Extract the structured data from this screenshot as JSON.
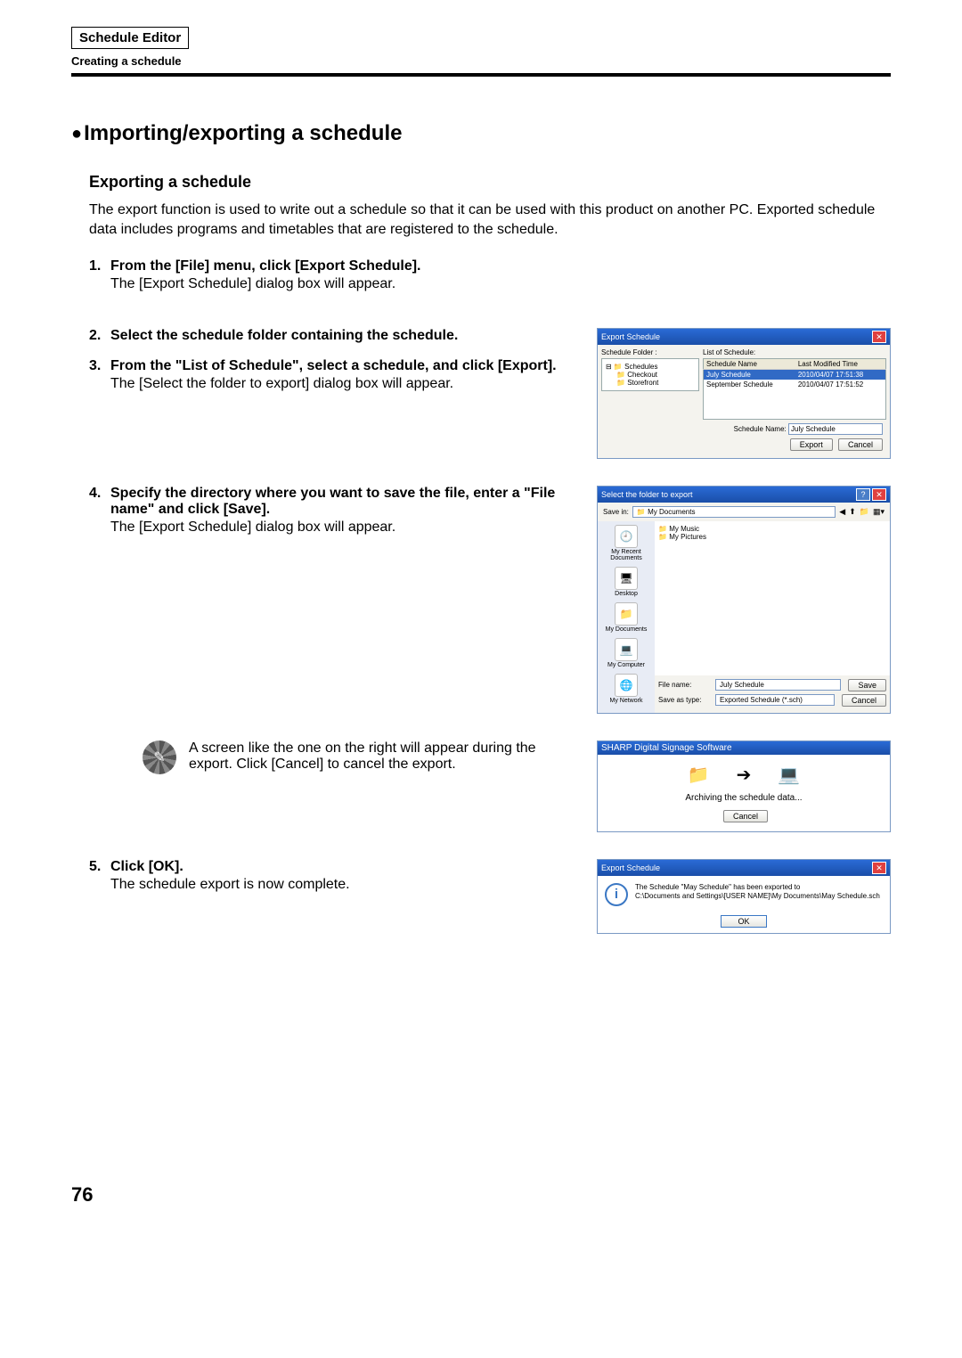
{
  "header": {
    "box": "Schedule Editor",
    "sub": "Creating a schedule"
  },
  "section_title": "Importing/exporting a schedule",
  "sub_title": "Exporting a schedule",
  "intro": "The export function is used to write out a schedule so that it can be used with this product on another PC. Exported schedule data includes programs and timetables that are registered to the schedule.",
  "steps": {
    "s1": {
      "num": "1.",
      "head": "From the [File] menu, click [Export Schedule].",
      "body": "The [Export Schedule] dialog box will appear."
    },
    "s2": {
      "num": "2.",
      "head": "Select the schedule folder containing the schedule."
    },
    "s3": {
      "num": "3.",
      "head": "From the \"List of Schedule\", select a schedule, and click [Export].",
      "body": "The [Select the folder to export] dialog box will appear."
    },
    "s4": {
      "num": "4.",
      "head": "Specify the directory where you want to save the file, enter a \"File name\" and click [Save].",
      "body": "The [Export Schedule] dialog box will appear."
    },
    "note": "A screen like the one on the right will appear during the export. Click [Cancel] to cancel the export.",
    "s5": {
      "num": "5.",
      "head": "Click [OK].",
      "body": "The schedule export is now complete."
    }
  },
  "dlg_export": {
    "title": "Export Schedule",
    "left_label": "Schedule Folder :",
    "tree": [
      "Schedules",
      "Checkout",
      "Storefront"
    ],
    "right_label": "List of Schedule:",
    "col1": "Schedule Name",
    "col2": "Last Modified Time",
    "rows": [
      {
        "name": "July Schedule",
        "time": "2010/04/07 17:51:38"
      },
      {
        "name": "September Schedule",
        "time": "2010/04/07 17:51:52"
      }
    ],
    "name_label": "Schedule Name:",
    "name_value": "July Schedule",
    "export_btn": "Export",
    "cancel_btn": "Cancel"
  },
  "dlg_save": {
    "title": "Select the folder to export",
    "savein_label": "Save in:",
    "savein_value": "My Documents",
    "side": {
      "recent": "My Recent Documents",
      "desktop": "Desktop",
      "mydocs": "My Documents",
      "mycomp": "My Computer",
      "mynet": "My Network"
    },
    "files": [
      "My Music",
      "My Pictures"
    ],
    "filename_label": "File name:",
    "filename_value": "July Schedule",
    "savetype_label": "Save as type:",
    "savetype_value": "Exported Schedule (*.sch)",
    "save_btn": "Save",
    "cancel_btn": "Cancel"
  },
  "dlg_prog": {
    "title": "SHARP Digital Signage Software",
    "text": "Archiving the schedule data...",
    "cancel_btn": "Cancel"
  },
  "dlg_conf": {
    "title": "Export Schedule",
    "line1": "The Schedule \"May Schedule\" has been exported to",
    "line2": "C:\\Documents and Settings\\[USER NAME]\\My Documents\\May Schedule.sch",
    "ok_btn": "OK"
  },
  "page_num": "76"
}
